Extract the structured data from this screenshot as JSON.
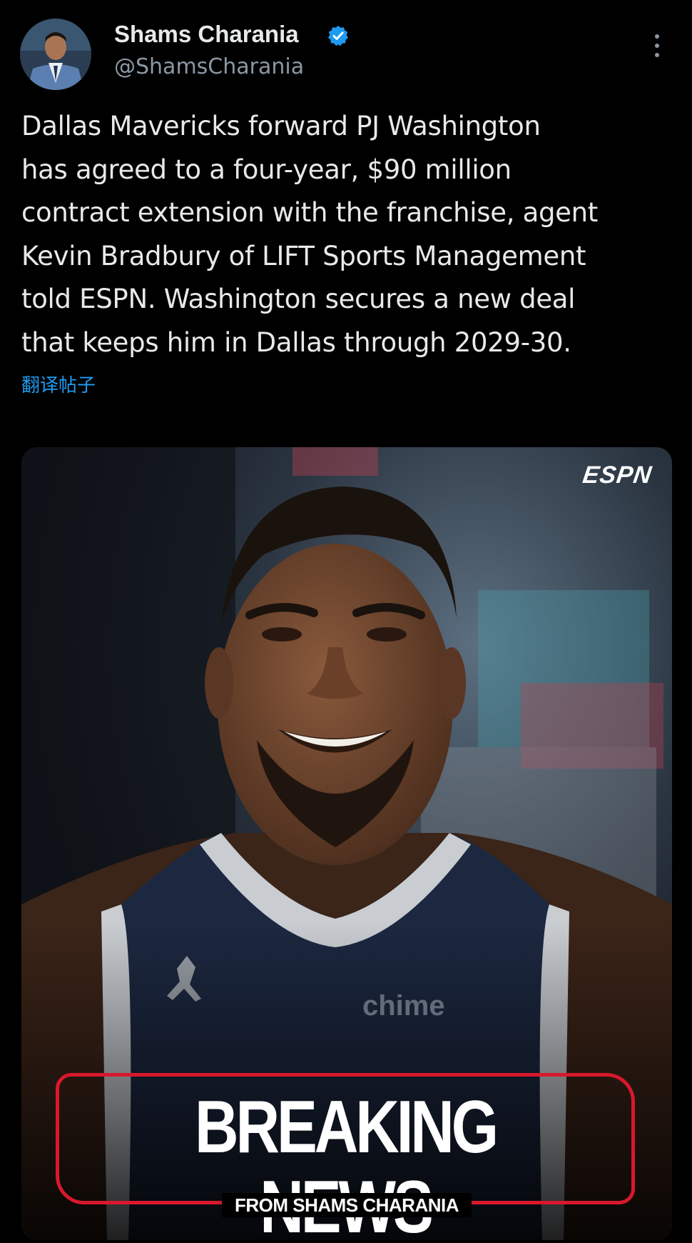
{
  "tweet": {
    "author_name": "Shams Charania",
    "handle": "@ShamsCharania",
    "text": "Dallas Mavericks forward PJ Washington\nhas agreed to a four-year, $90 million\ncontract extension with the franchise, agent\nKevin Bradbury of LIFT Sports Management\ntold ESPN. Washington secures a new deal\nthat keeps him in Dallas through 2029-30.",
    "translate_label": "翻译帖子"
  },
  "media": {
    "logo": "ESPN",
    "jersey_text": "chime",
    "headline": "BREAKING NEWS",
    "subline": "FROM SHAMS CHARANIA"
  },
  "colors": {
    "background": "#000000",
    "text": "#e7e9ea",
    "secondary": "#8b98a5",
    "link": "#1d9bf0",
    "verified": "#1d9bf0",
    "breaking_red": "#d8182c"
  },
  "icons": {
    "verified": "verified-badge-icon",
    "more": "more-vertical-icon"
  }
}
